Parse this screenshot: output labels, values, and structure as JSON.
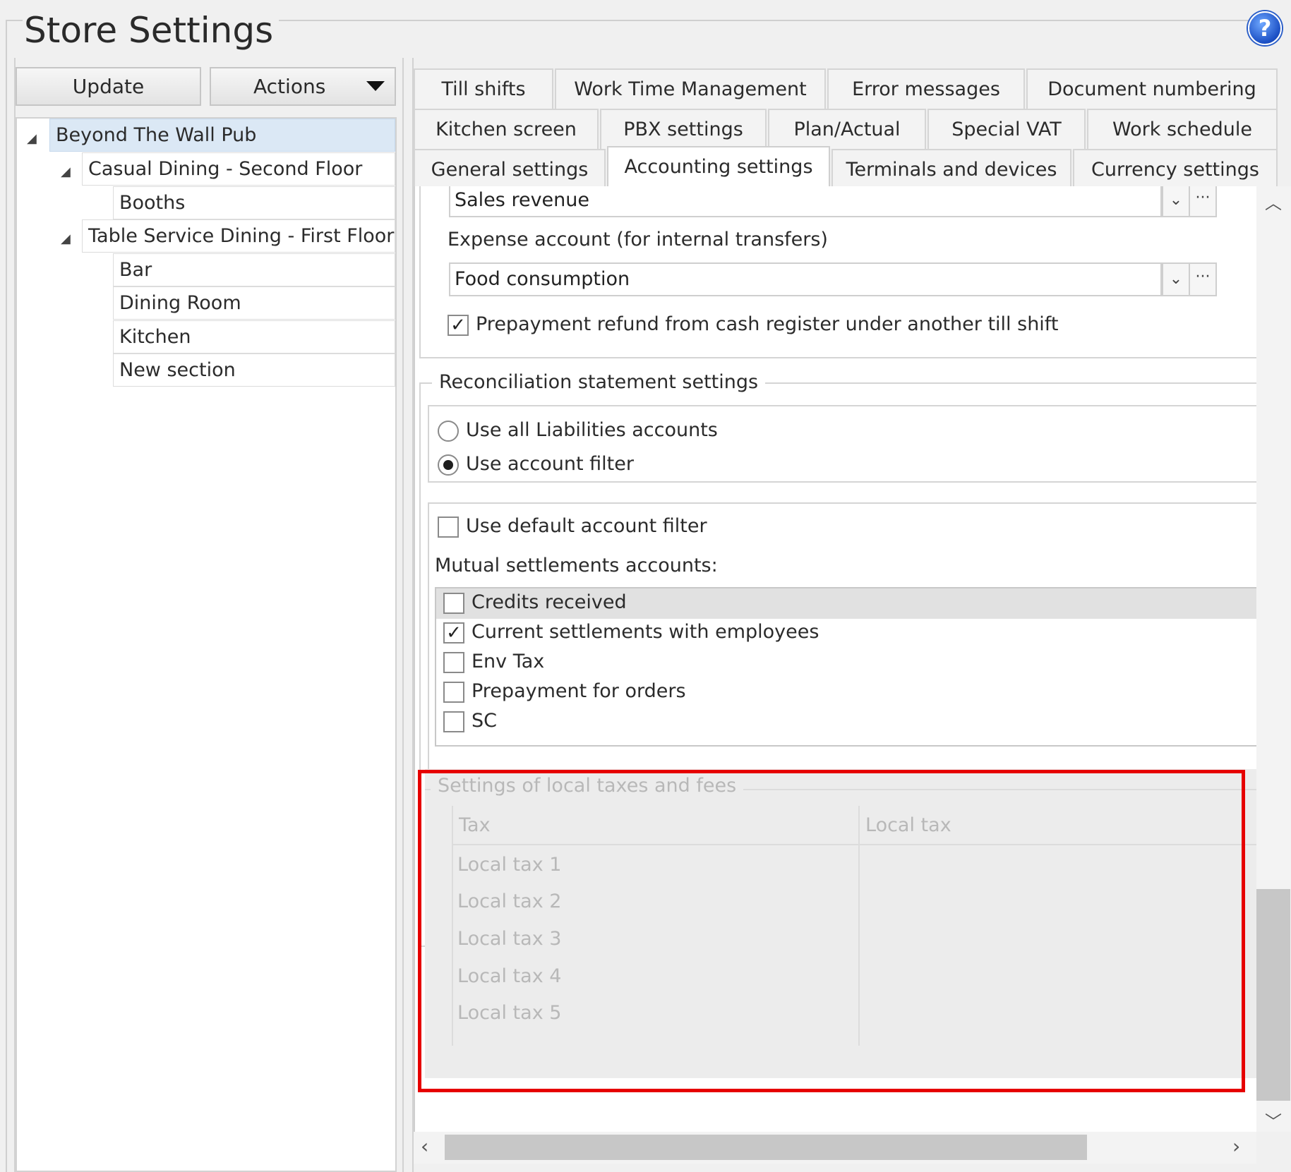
{
  "window": {
    "title": "Store Settings",
    "help_icon": "?"
  },
  "toolbar": {
    "update_label": "Update",
    "actions_label": "Actions"
  },
  "tree": {
    "root": "Beyond The Wall Pub",
    "groups": [
      {
        "label": "Casual Dining - Second Floor",
        "children": [
          "Booths"
        ]
      },
      {
        "label": "Table Service Dining - First Floor",
        "children": [
          "Bar",
          "Dining Room",
          "Kitchen",
          "New section"
        ]
      }
    ]
  },
  "tabs": {
    "row1": [
      "Till shifts",
      "Work Time Management",
      "Error messages",
      "Document numbering"
    ],
    "row2": [
      "Kitchen screen",
      "PBX settings",
      "Plan/Actual",
      "Special VAT",
      "Work schedule"
    ],
    "row3": [
      "General settings",
      "Accounting settings",
      "Terminals and devices",
      "Currency settings"
    ],
    "active": "Accounting settings"
  },
  "accounting": {
    "sales_revenue_value": "Sales revenue",
    "expense_label": "Expense account (for internal transfers)",
    "expense_value": "Food consumption",
    "prepayment_refund_label": "Prepayment refund from cash register under another till shift",
    "prepayment_refund_checked": true
  },
  "reconciliation": {
    "legend": "Reconciliation statement settings",
    "radio_all": "Use all Liabilities accounts",
    "radio_filter": "Use account filter",
    "selected": "Use account filter",
    "default_filter_label": "Use default account filter",
    "mutual_label": "Mutual settlements accounts:",
    "accounts": [
      {
        "name": "Credits received",
        "checked": false
      },
      {
        "name": "Current settlements with employees",
        "checked": true
      },
      {
        "name": "Env Tax",
        "checked": false
      },
      {
        "name": "Prepayment for orders",
        "checked": false
      },
      {
        "name": "SC",
        "checked": false
      }
    ]
  },
  "local_taxes": {
    "legend": "Settings of local taxes and fees",
    "col_tax": "Tax",
    "col_local": "Local tax",
    "rows": [
      "Local tax 1",
      "Local tax 2",
      "Local tax 3",
      "Local tax 4",
      "Local tax 5"
    ]
  },
  "icons": {
    "dropdown": "chevron-down-icon",
    "ellipsis": "ellipsis-icon",
    "check": "check-icon"
  }
}
